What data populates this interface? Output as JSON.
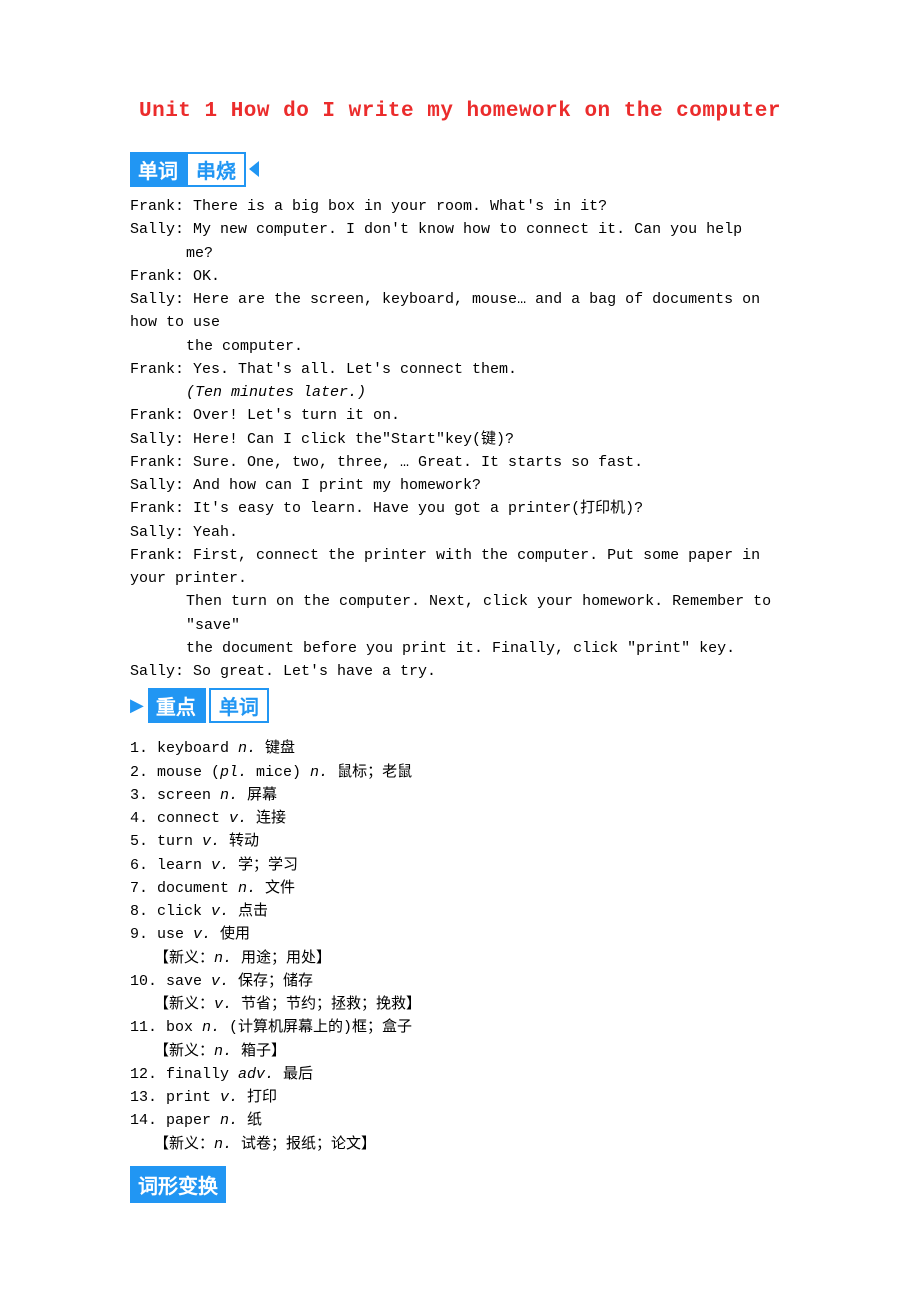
{
  "title": "Unit 1 How do I write my homework on the computer",
  "badge1": {
    "left": "单词",
    "right": "串烧"
  },
  "dialogue": [
    "Frank: There is a big box in your room. What's in it?",
    " Sally: My new computer. I don't know how to connect it. Can you help",
    "me?",
    "Frank: OK.",
    " Sally: Here are the screen, keyboard, mouse… and a bag of documents on how to use",
    "the computer.",
    "Frank: Yes. That's all. Let's connect them.",
    "(Ten minutes later.)",
    "Frank: Over! Let's turn it on.",
    " Sally: Here! Can I click the\"Start\"key(键)?",
    "Frank: Sure. One, two, three, … Great. It starts so fast.",
    " Sally: And how can I print my homework?",
    "Frank: It's easy to learn. Have you got a printer(打印机)?",
    " Sally: Yeah.",
    "Frank: First, connect the printer with the computer. Put some paper in your printer.",
    "Then turn on the computer. Next, click your homework. Remember to \"save\"",
    "the document before you print it. Finally, click \"print\" key.",
    "Sally: So great. Let's have a try."
  ],
  "dialogue_indent": [
    false,
    false,
    true,
    false,
    false,
    true,
    false,
    true,
    false,
    false,
    false,
    false,
    false,
    false,
    false,
    true,
    true,
    false
  ],
  "dialogue_italic": [
    false,
    false,
    false,
    false,
    false,
    false,
    false,
    true,
    false,
    false,
    false,
    false,
    false,
    false,
    false,
    false,
    false,
    false
  ],
  "badge2": {
    "symbol": "▶",
    "left": "重点",
    "right": "单词"
  },
  "vocab": [
    {
      "num": "1.",
      "word": "keyboard",
      "pos": "n.",
      "zh": "键盘"
    },
    {
      "num": "2.",
      "word": "mouse (",
      "pos_inline": "pl.",
      "word2": " mice)",
      "pos": "n.",
      "zh": "鼠标；老鼠"
    },
    {
      "num": "3.",
      "word": "screen",
      "pos": "n.",
      "zh": "屏幕"
    },
    {
      "num": "4.",
      "word": "connect",
      "pos": "v.",
      "zh": "连接"
    },
    {
      "num": "5.",
      "word": "turn",
      "pos": "v.",
      "zh": "转动"
    },
    {
      "num": "6.",
      "word": "learn",
      "pos": "v.",
      "zh": "学；学习"
    },
    {
      "num": "7.",
      "word": "document",
      "pos": "n.",
      "zh": "文件"
    },
    {
      "num": "8.",
      "word": "click",
      "pos": "v.",
      "zh": "点击"
    },
    {
      "num": "9.",
      "word": "use",
      "pos": "v.",
      "zh": "使用",
      "note_pos": "n.",
      "note_zh": "用途；用处"
    },
    {
      "num": "10.",
      "word": "save",
      "pos": "v.",
      "zh": "保存；储存",
      "note_pos": "v.",
      "note_zh": "节省；节约；拯救；挽救"
    },
    {
      "num": "11.",
      "word": "box",
      "pos": "n.",
      "zh": "(计算机屏幕上的)框；盒子",
      "note_pos": "n.",
      "note_zh": "箱子"
    },
    {
      "num": "12.",
      "word": "finally",
      "pos": "adv.",
      "zh": "最后"
    },
    {
      "num": "13.",
      "word": "print",
      "pos": "v.",
      "zh": " 打印"
    },
    {
      "num": "14.",
      "word": "paper",
      "pos": "n.",
      "zh": "纸",
      "note_pos": "n.",
      "note_zh": "试卷；报纸；论文"
    }
  ],
  "note_prefix": "【新义：",
  "note_suffix": "】",
  "badge3": "词形变换"
}
